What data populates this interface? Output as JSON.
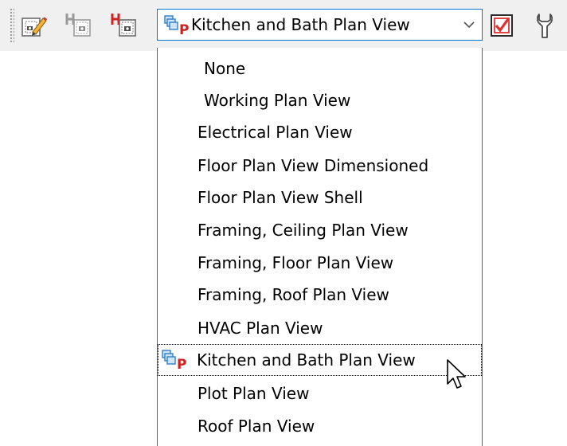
{
  "toolbar": {
    "buttons": [
      {
        "name": "edit-view-button",
        "icon": "camera-view-pencil-icon"
      },
      {
        "name": "view-button-gray",
        "icon": "camera-view-gray-icon"
      },
      {
        "name": "view-button-red",
        "icon": "camera-view-red-icon"
      },
      {
        "name": "checkbox-button",
        "icon": "red-checkmark-box-icon"
      },
      {
        "name": "wrench-button",
        "icon": "wrench-icon"
      }
    ],
    "plan_view_select": {
      "value": "Kitchen and Bath Plan View",
      "icon": "layer-set-p-icon"
    }
  },
  "dropdown": {
    "options": [
      "None",
      "Working Plan View",
      "Electrical Plan View",
      "Floor Plan View Dimensioned",
      "Floor Plan View Shell",
      "Framing, Ceiling Plan View",
      "Framing, Floor Plan View",
      "Framing, Roof Plan View",
      "HVAC Plan View",
      "Kitchen and Bath Plan View",
      "Plot Plan View",
      "Roof Plan View"
    ],
    "selected_index": 9
  },
  "colors": {
    "focus_border": "#0078d7",
    "check_red": "#e03030",
    "icon_blue": "#2f80c8",
    "icon_red": "#d21f1f"
  }
}
